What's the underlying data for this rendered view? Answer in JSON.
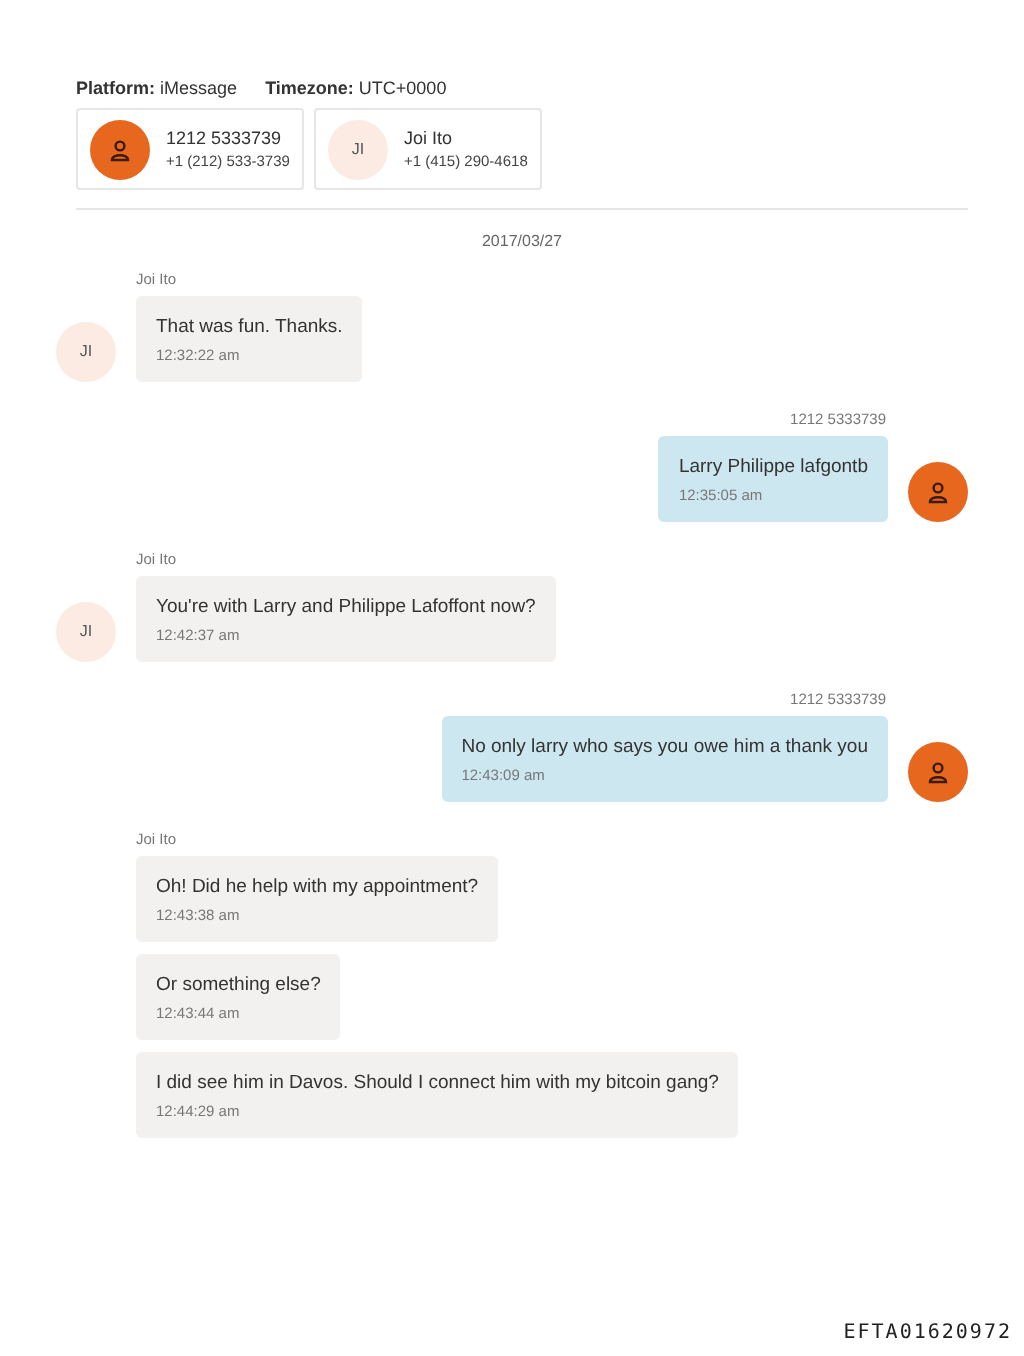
{
  "header": {
    "platform_label": "Platform:",
    "platform": "iMessage",
    "timezone_label": "Timezone:",
    "timezone": "UTC+0000"
  },
  "participants": [
    {
      "kind": "self",
      "name": "1212 5333739",
      "phone": "+1 (212) 533-3739"
    },
    {
      "kind": "contact",
      "initials": "JI",
      "name": "Joi Ito",
      "phone": "+1 (415) 290-4618"
    }
  ],
  "date": "2017/03/27",
  "groups": [
    {
      "kind": "incoming",
      "sender": "Joi Ito",
      "messages": [
        {
          "text": "That was fun. Thanks.",
          "time": "12:32:22 am",
          "avatar_initials": "JI"
        }
      ]
    },
    {
      "kind": "outgoing",
      "sender": "1212 5333739",
      "messages": [
        {
          "text": "Larry  Philippe lafgontb",
          "time": "12:35:05 am",
          "show_avatar": true
        }
      ]
    },
    {
      "kind": "incoming",
      "sender": "Joi Ito",
      "messages": [
        {
          "text": "You're with Larry and Philippe Lafoffont now?",
          "time": "12:42:37 am",
          "avatar_initials": "JI"
        }
      ]
    },
    {
      "kind": "outgoing",
      "sender": "1212 5333739",
      "messages": [
        {
          "text": "No only larry who says you owe him a thank you",
          "time": "12:43:09 am",
          "show_avatar": true
        }
      ]
    },
    {
      "kind": "incoming",
      "sender": "Joi Ito",
      "messages": [
        {
          "text": "Oh! Did he help with my appointment?",
          "time": "12:43:38 am"
        },
        {
          "text": "Or something else?",
          "time": "12:43:44 am"
        },
        {
          "text": "I did see him in Davos. Should I connect him with my bitcoin gang?",
          "time": "12:44:29 am"
        }
      ]
    }
  ],
  "stamp": "EFTA01620972"
}
